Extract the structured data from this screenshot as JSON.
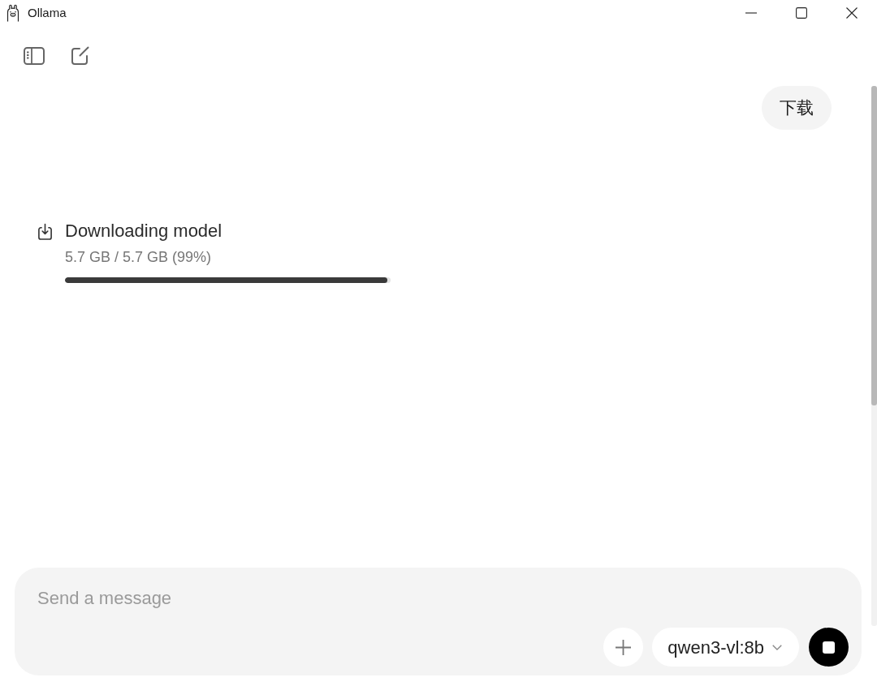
{
  "window": {
    "title": "Ollama"
  },
  "user_message": {
    "text": "下载"
  },
  "download": {
    "title": "Downloading model",
    "progress_text": "5.7 GB / 5.7 GB (99%)",
    "level": 0.99
  },
  "composer": {
    "placeholder": "Send a message",
    "model": "qwen3-vl:8b"
  }
}
